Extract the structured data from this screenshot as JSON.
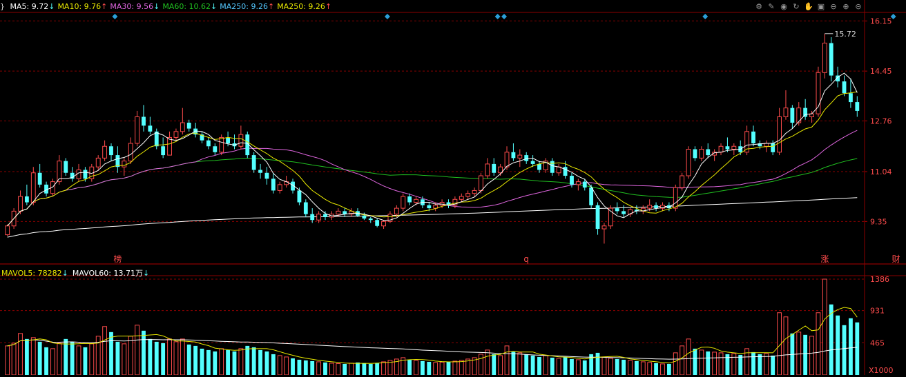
{
  "colors": {
    "up": "#ff4c4c",
    "down": "#54ffff",
    "ma5": "#ffffff",
    "ma10": "#e9e900",
    "ma30": "#e066e0",
    "ma60": "#20c020",
    "ma250": "#ffffff",
    "vol5": "#e9e900",
    "vol60": "#ffffff",
    "grid": "#8b0000"
  },
  "legend": {
    "prefix": "}",
    "items": [
      {
        "label": "MA5: 9.72",
        "arrow": "↓",
        "color": "#ffffff"
      },
      {
        "label": "MA10: 9.76",
        "arrow": "↑",
        "color": "#e9e900"
      },
      {
        "label": "MA30: 9.56",
        "arrow": "↓",
        "color": "#e066e0"
      },
      {
        "label": "MA60: 10.62",
        "arrow": "↓",
        "color": "#20c020"
      },
      {
        "label": "MA250: 9.26",
        "arrow": "↑",
        "color": "#54c8ff"
      },
      {
        "label": "MA250: 9.26",
        "arrow": "↑",
        "color": "#e9e900"
      }
    ]
  },
  "vol_legend": {
    "items": [
      {
        "label": "MAVOL5: 78282",
        "arrow": "↓",
        "color": "#e9e900"
      },
      {
        "label": "MAVOL60: 13.71万",
        "arrow": "↓",
        "color": "#ffffff"
      }
    ]
  },
  "toolbar": [
    "gear-icon",
    "pencil-icon",
    "eye-icon",
    "cycle-icon",
    "hand-icon",
    "lock-icon",
    "minus-circle-icon",
    "plus-circle-icon",
    "remove-icon"
  ],
  "chart_data": {
    "type": "candlestick",
    "price_axis": {
      "ticks": [
        "16.15",
        "14.45",
        "12.76",
        "11.04",
        "9.35"
      ],
      "range": [
        8.4,
        16.3
      ]
    },
    "volume_axis": {
      "ticks": [
        "1386",
        "931",
        "465"
      ],
      "unit": "X1000",
      "range": [
        0,
        1386
      ]
    },
    "max_label": "15.72",
    "event_markers": [
      "榜",
      "q",
      "财",
      "涨"
    ],
    "ohlc": [
      [
        8.9,
        9.25,
        8.85,
        9.2
      ],
      [
        9.2,
        9.8,
        9.1,
        9.7
      ],
      [
        9.7,
        10.4,
        9.6,
        10.2
      ],
      [
        10.2,
        10.6,
        9.9,
        10.0
      ],
      [
        10.0,
        11.2,
        9.9,
        11.0
      ],
      [
        11.0,
        11.3,
        10.5,
        10.6
      ],
      [
        10.6,
        10.7,
        10.2,
        10.3
      ],
      [
        10.3,
        10.8,
        10.2,
        10.7
      ],
      [
        10.7,
        11.6,
        10.6,
        11.4
      ],
      [
        11.4,
        11.5,
        10.9,
        11.0
      ],
      [
        11.0,
        11.2,
        10.7,
        10.8
      ],
      [
        10.8,
        11.3,
        10.7,
        11.1
      ],
      [
        11.1,
        11.2,
        10.7,
        10.8
      ],
      [
        10.8,
        11.3,
        10.7,
        11.2
      ],
      [
        11.2,
        11.6,
        11.1,
        11.5
      ],
      [
        11.5,
        12.1,
        11.4,
        11.9
      ],
      [
        11.9,
        12.0,
        11.4,
        11.6
      ],
      [
        11.6,
        11.9,
        11.0,
        11.2
      ],
      [
        11.2,
        11.5,
        10.9,
        11.4
      ],
      [
        11.4,
        12.2,
        11.3,
        12.0
      ],
      [
        12.0,
        13.1,
        11.9,
        12.9
      ],
      [
        12.9,
        13.3,
        12.4,
        12.6
      ],
      [
        12.6,
        12.9,
        12.3,
        12.4
      ],
      [
        12.4,
        12.5,
        11.8,
        11.9
      ],
      [
        11.9,
        12.2,
        11.5,
        11.6
      ],
      [
        11.6,
        12.4,
        11.6,
        12.2
      ],
      [
        12.2,
        12.5,
        12.1,
        12.4
      ],
      [
        12.4,
        13.2,
        12.3,
        12.7
      ],
      [
        12.7,
        12.8,
        12.4,
        12.5
      ],
      [
        12.5,
        12.7,
        12.2,
        12.3
      ],
      [
        12.3,
        12.4,
        12.0,
        12.1
      ],
      [
        12.1,
        12.2,
        11.8,
        11.9
      ],
      [
        11.9,
        12.0,
        11.6,
        11.7
      ],
      [
        11.7,
        12.3,
        11.6,
        12.2
      ],
      [
        12.2,
        12.4,
        11.9,
        12.0
      ],
      [
        12.0,
        12.3,
        11.8,
        11.9
      ],
      [
        11.9,
        12.6,
        11.8,
        12.3
      ],
      [
        12.3,
        12.4,
        11.5,
        11.6
      ],
      [
        11.6,
        11.7,
        11.0,
        11.1
      ],
      [
        11.1,
        11.3,
        10.8,
        11.0
      ],
      [
        11.0,
        11.2,
        10.6,
        10.8
      ],
      [
        10.8,
        11.0,
        10.3,
        10.4
      ],
      [
        10.4,
        10.7,
        10.3,
        10.6
      ],
      [
        10.6,
        10.9,
        10.5,
        10.7
      ],
      [
        10.7,
        10.8,
        10.3,
        10.4
      ],
      [
        10.4,
        10.5,
        9.9,
        10.0
      ],
      [
        10.0,
        10.1,
        9.5,
        9.6
      ],
      [
        9.6,
        9.8,
        9.3,
        9.4
      ],
      [
        9.4,
        9.7,
        9.3,
        9.6
      ],
      [
        9.6,
        9.7,
        9.4,
        9.5
      ],
      [
        9.5,
        9.7,
        9.4,
        9.6
      ],
      [
        9.6,
        9.8,
        9.5,
        9.7
      ],
      [
        9.7,
        9.8,
        9.5,
        9.6
      ],
      [
        9.6,
        9.8,
        9.5,
        9.7
      ],
      [
        9.7,
        9.8,
        9.5,
        9.55
      ],
      [
        9.55,
        9.65,
        9.4,
        9.45
      ],
      [
        9.45,
        9.5,
        9.3,
        9.4
      ],
      [
        9.4,
        9.45,
        9.15,
        9.2
      ],
      [
        9.2,
        9.4,
        9.1,
        9.35
      ],
      [
        9.35,
        9.7,
        9.3,
        9.6
      ],
      [
        9.6,
        9.9,
        9.5,
        9.8
      ],
      [
        9.8,
        10.3,
        9.7,
        10.2
      ],
      [
        10.2,
        10.3,
        9.9,
        10.0
      ],
      [
        10.0,
        10.2,
        9.9,
        10.1
      ],
      [
        10.1,
        10.2,
        9.8,
        9.9
      ],
      [
        9.9,
        10.0,
        9.7,
        9.8
      ],
      [
        9.8,
        10.0,
        9.7,
        9.9
      ],
      [
        9.9,
        10.1,
        9.8,
        10.0
      ],
      [
        10.0,
        10.1,
        9.8,
        9.9
      ],
      [
        9.9,
        10.2,
        9.8,
        10.1
      ],
      [
        10.1,
        10.3,
        10.0,
        10.2
      ],
      [
        10.2,
        10.4,
        10.1,
        10.3
      ],
      [
        10.3,
        10.5,
        10.2,
        10.4
      ],
      [
        10.4,
        11.0,
        10.3,
        10.9
      ],
      [
        10.9,
        11.5,
        10.8,
        11.3
      ],
      [
        11.3,
        11.5,
        10.9,
        11.0
      ],
      [
        11.0,
        11.3,
        10.9,
        11.2
      ],
      [
        11.2,
        11.9,
        11.1,
        11.7
      ],
      [
        11.7,
        12.0,
        11.4,
        11.5
      ],
      [
        11.5,
        11.8,
        11.2,
        11.6
      ],
      [
        11.6,
        11.7,
        11.3,
        11.4
      ],
      [
        11.4,
        11.6,
        11.2,
        11.3
      ],
      [
        11.3,
        11.4,
        11.0,
        11.1
      ],
      [
        11.1,
        11.5,
        11.0,
        11.4
      ],
      [
        11.4,
        11.5,
        10.9,
        11.0
      ],
      [
        11.0,
        11.3,
        10.9,
        11.2
      ],
      [
        11.2,
        11.4,
        10.8,
        10.9
      ],
      [
        10.9,
        11.0,
        10.5,
        10.6
      ],
      [
        10.6,
        10.8,
        10.4,
        10.7
      ],
      [
        10.7,
        10.8,
        10.4,
        10.5
      ],
      [
        10.5,
        10.6,
        9.8,
        9.9
      ],
      [
        9.9,
        10.0,
        8.9,
        9.1
      ],
      [
        9.1,
        9.3,
        8.6,
        9.2
      ],
      [
        9.2,
        9.9,
        9.1,
        9.8
      ],
      [
        9.8,
        10.0,
        9.6,
        9.7
      ],
      [
        9.7,
        9.9,
        9.5,
        9.6
      ],
      [
        9.6,
        9.8,
        9.5,
        9.75
      ],
      [
        9.75,
        9.9,
        9.6,
        9.7
      ],
      [
        9.7,
        9.9,
        9.6,
        9.8
      ],
      [
        9.8,
        10.1,
        9.7,
        9.9
      ],
      [
        9.9,
        10.0,
        9.7,
        9.8
      ],
      [
        9.8,
        10.0,
        9.7,
        9.9
      ],
      [
        9.9,
        10.0,
        9.7,
        9.8
      ],
      [
        9.8,
        10.6,
        9.7,
        10.5
      ],
      [
        10.5,
        11.0,
        10.4,
        10.9
      ],
      [
        10.9,
        11.9,
        10.8,
        11.8
      ],
      [
        11.8,
        11.9,
        11.4,
        11.5
      ],
      [
        11.5,
        11.9,
        11.4,
        11.8
      ],
      [
        11.8,
        12.0,
        11.5,
        11.6
      ],
      [
        11.6,
        11.8,
        11.4,
        11.7
      ],
      [
        11.7,
        12.0,
        11.6,
        11.9
      ],
      [
        11.9,
        12.2,
        11.7,
        11.8
      ],
      [
        11.8,
        12.0,
        11.6,
        11.9
      ],
      [
        11.9,
        12.1,
        11.6,
        11.7
      ],
      [
        11.7,
        12.6,
        11.6,
        12.4
      ],
      [
        12.4,
        12.6,
        11.9,
        12.0
      ],
      [
        12.0,
        12.1,
        11.8,
        11.9
      ],
      [
        11.9,
        12.1,
        11.7,
        12.0
      ],
      [
        12.0,
        12.1,
        11.6,
        11.7
      ],
      [
        11.7,
        13.2,
        11.6,
        12.9
      ],
      [
        12.9,
        13.8,
        12.8,
        13.2
      ],
      [
        13.2,
        13.3,
        12.5,
        12.7
      ],
      [
        12.7,
        13.4,
        12.6,
        13.2
      ],
      [
        13.2,
        13.5,
        12.8,
        12.9
      ],
      [
        12.9,
        13.1,
        12.7,
        13.0
      ],
      [
        13.0,
        14.6,
        12.9,
        14.4
      ],
      [
        14.4,
        15.72,
        14.2,
        15.4
      ],
      [
        15.4,
        15.6,
        14.1,
        14.3
      ],
      [
        14.3,
        14.6,
        13.9,
        14.1
      ],
      [
        14.1,
        14.3,
        13.6,
        13.7
      ],
      [
        13.7,
        14.2,
        13.2,
        13.4
      ],
      [
        13.4,
        13.6,
        12.9,
        13.1
      ]
    ],
    "volumes": [
      420,
      460,
      600,
      520,
      540,
      480,
      400,
      380,
      460,
      520,
      480,
      420,
      400,
      450,
      560,
      700,
      620,
      480,
      450,
      560,
      720,
      640,
      520,
      480,
      460,
      520,
      480,
      520,
      440,
      420,
      380,
      360,
      340,
      380,
      360,
      340,
      380,
      420,
      400,
      360,
      340,
      300,
      280,
      260,
      240,
      220,
      210,
      200,
      190,
      180,
      170,
      165,
      160,
      170,
      180,
      170,
      160,
      175,
      190,
      210,
      230,
      250,
      220,
      210,
      200,
      190,
      180,
      185,
      190,
      200,
      210,
      230,
      250,
      300,
      360,
      300,
      280,
      420,
      340,
      320,
      300,
      280,
      260,
      280,
      250,
      240,
      260,
      230,
      220,
      210,
      300,
      320,
      260,
      240,
      230,
      220,
      210,
      200,
      190,
      180,
      170,
      160,
      160,
      320,
      420,
      520,
      380,
      360,
      340,
      330,
      320,
      300,
      310,
      290,
      380,
      330,
      300,
      310,
      280,
      900,
      840,
      600,
      620,
      580,
      560,
      900,
      1386,
      1020,
      860,
      720,
      820,
      760
    ]
  }
}
